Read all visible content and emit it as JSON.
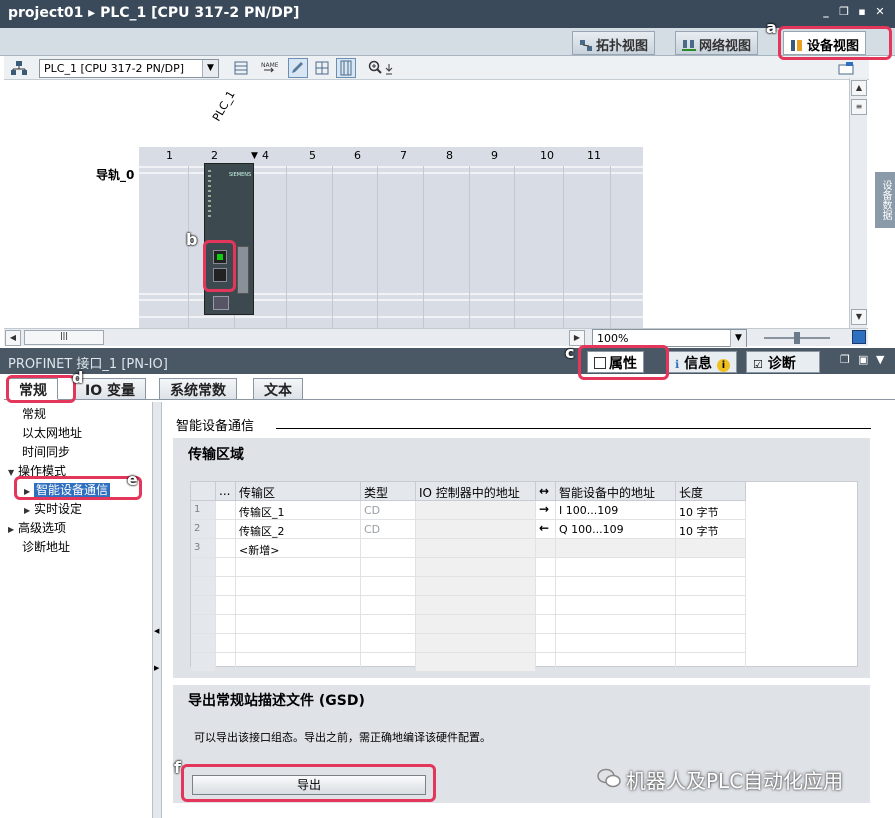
{
  "window": {
    "title": "project01 ▸ PLC_1 [CPU 317-2 PN/DP]"
  },
  "view_tabs": [
    {
      "label": "拓扑视图"
    },
    {
      "label": "网络视图"
    },
    {
      "label": "设备视图",
      "active": true
    }
  ],
  "toolbar": {
    "device_select": "PLC_1 [CPU 317-2 PN/DP]",
    "zoom": "100%"
  },
  "canvas": {
    "plc_label": "PLC_1",
    "rail_label": "导轨_0",
    "slots": [
      "1",
      "2",
      "4",
      "5",
      "6",
      "7",
      "8",
      "9",
      "10",
      "11"
    ],
    "cpu_brand": "SIEMENS",
    "side_tab": "设备数据"
  },
  "inspector": {
    "title": "PROFINET 接口_1 [PN-IO]",
    "tabs": [
      {
        "label": "属性"
      },
      {
        "label": "信息"
      },
      {
        "label": "诊断"
      }
    ]
  },
  "property_tabs": [
    {
      "label": "常规"
    },
    {
      "label": "IO 变量"
    },
    {
      "label": "系统常数"
    },
    {
      "label": "文本"
    }
  ],
  "nav": [
    {
      "label": "常规"
    },
    {
      "label": "以太网地址"
    },
    {
      "label": "时间同步"
    },
    {
      "label": "操作模式"
    },
    {
      "label": "智能设备通信"
    },
    {
      "label": "实时设定"
    },
    {
      "label": "高级选项"
    },
    {
      "label": "诊断地址"
    }
  ],
  "section_title": "智能设备通信",
  "transfer": {
    "title": "传输区域",
    "headers": [
      "...",
      "传输区",
      "类型",
      "IO 控制器中的地址",
      "↔",
      "智能设备中的地址",
      "长度"
    ],
    "rows": [
      {
        "n": "1",
        "name": "传输区_1",
        "type": "CD",
        "ctrl": "",
        "dir": "→",
        "dev": "I 100...109",
        "len": "10 字节"
      },
      {
        "n": "2",
        "name": "传输区_2",
        "type": "CD",
        "ctrl": "",
        "dir": "←",
        "dev": "Q 100...109",
        "len": "10 字节"
      },
      {
        "n": "3",
        "name": "<新增>",
        "type": "",
        "ctrl": "",
        "dir": "",
        "dev": "",
        "len": ""
      }
    ]
  },
  "gsd": {
    "title": "导出常规站描述文件 (GSD)",
    "desc": "可以导出该接口组态。导出之前，需正确地编译该硬件配置。",
    "button": "导出"
  },
  "annotations": [
    "a",
    "b",
    "c",
    "d",
    "e",
    "f"
  ],
  "watermark": "机器人及PLC自动化应用",
  "colors": {
    "highlight": "#e4365a",
    "selection": "#2f6fbf",
    "header": "#4a5866"
  }
}
